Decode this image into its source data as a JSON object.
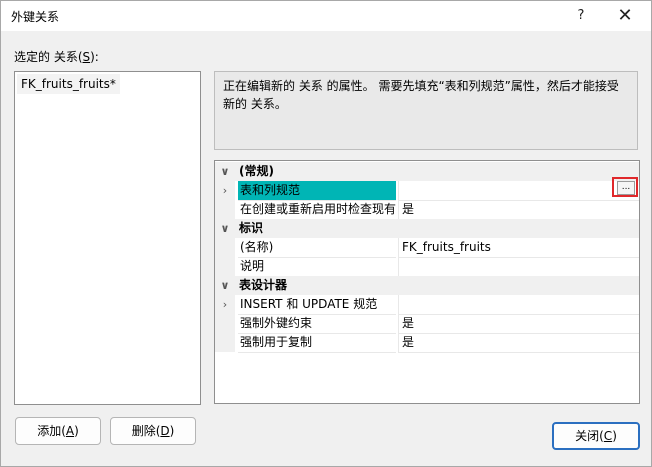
{
  "window": {
    "title": "外键关系",
    "help_glyph": "?",
    "close_glyph": "✕"
  },
  "selected_label_prefix": "选定的 关系(",
  "selected_label_key": "S",
  "selected_label_suffix": "):",
  "relations": [
    "FK_fruits_fruits*"
  ],
  "description": "正在编辑新的 关系 的属性。 需要先填充“表和列规范”属性，然后才能接受新的 关系。",
  "properties": {
    "cat_general": "(常规)",
    "table_col_spec": "表和列规范",
    "check_existing": "在创建或重新启用时检查现有",
    "check_existing_value": "是",
    "cat_identity": "标识",
    "name_label": "(名称)",
    "name_value": "FK_fruits_fruits",
    "desc_label": "说明",
    "desc_value": "",
    "cat_designer": "表设计器",
    "insert_update": "INSERT 和 UPDATE 规范",
    "enforce_fk": "强制外键约束",
    "enforce_fk_value": "是",
    "enforce_repl": "强制用于复制",
    "enforce_repl_value": "是",
    "ellipsis": "..."
  },
  "buttons": {
    "add_prefix": "添加(",
    "add_key": "A",
    "add_suffix": ")",
    "delete_prefix": "删除(",
    "delete_key": "D",
    "delete_suffix": ")",
    "close_prefix": "关闭(",
    "close_key": "C",
    "close_suffix": ")"
  },
  "colors": {
    "selected_row": "#00b5b5",
    "highlight_box": "#e0282b",
    "default_button_border": "#2b6fc0"
  }
}
